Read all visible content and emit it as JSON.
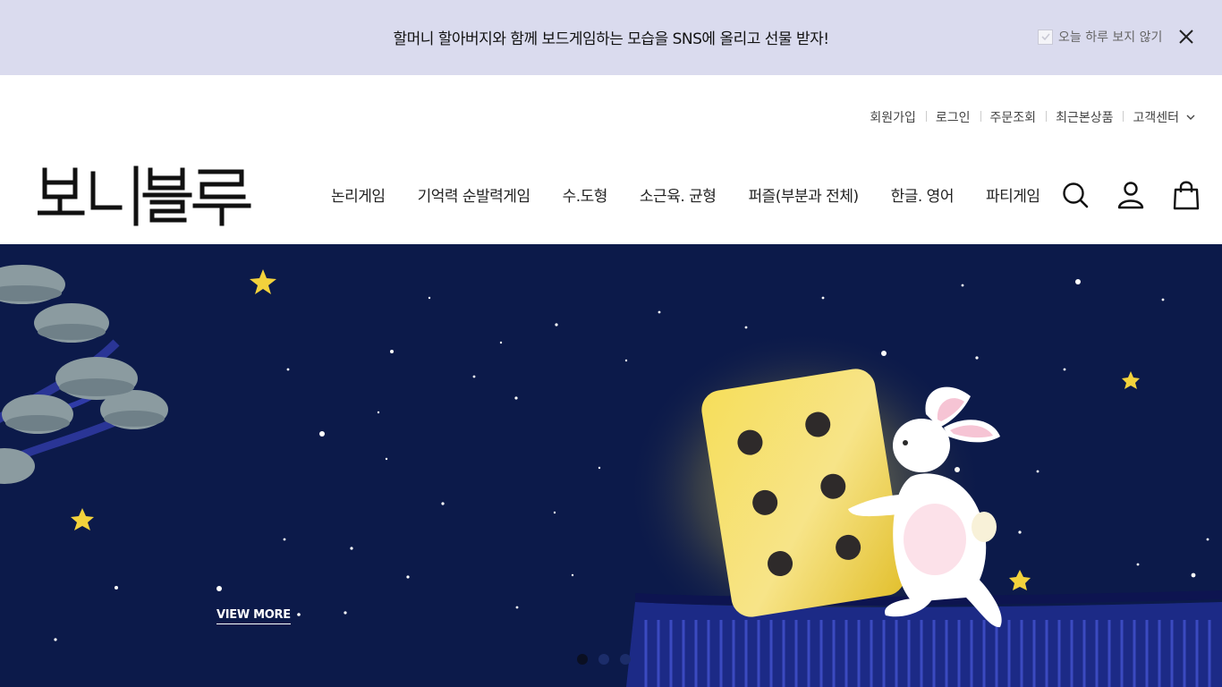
{
  "announcement": {
    "message": "할머니 할아버지와 함께 보드게임하는 모습을 SNS에 올리고 선물 받자!",
    "dismiss_label": "오늘 하루 보지 않기",
    "close_icon": "close-icon"
  },
  "utility_links": [
    "회원가입",
    "로그인",
    "주문조회",
    "최근본상품",
    "고객센터"
  ],
  "brand": {
    "logo_text": "보니블루"
  },
  "nav": {
    "items": [
      "논리게임",
      "기억력 순발력게임",
      "수.도형",
      "소근육. 균형",
      "퍼즐(부분과 전체)",
      "한글. 영어",
      "파티게임"
    ]
  },
  "header_icons": [
    "search-icon",
    "user-icon",
    "shopping-bag-icon"
  ],
  "hero": {
    "cta": "VIEW MORE",
    "slide_count": 3,
    "active_slide": 1,
    "bg_color": "#0c1a4a"
  },
  "colors": {
    "announcement_bg": "#dadbee",
    "hero_bg": "#0c1a4a",
    "dice": "#f3d53f"
  }
}
